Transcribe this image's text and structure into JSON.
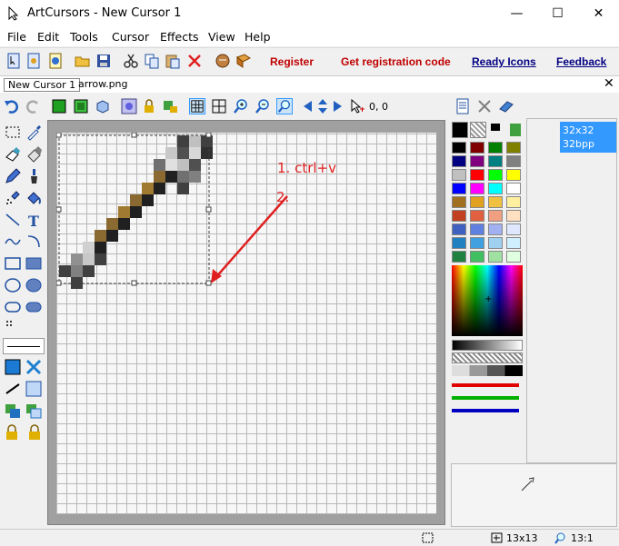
{
  "window": {
    "title": "ArtCursors - New Cursor 1",
    "minimize": "—",
    "maximize": "☐",
    "close": "✕"
  },
  "menu": [
    "File",
    "Edit",
    "Tools",
    "Cursor",
    "Effects",
    "View",
    "Help"
  ],
  "toolbar_links": {
    "register": "Register",
    "get_code": "Get registration code",
    "ready_icons": "Ready Icons",
    "feedback": "Feedback"
  },
  "tabs": [
    {
      "label": "New Cursor 1"
    },
    {
      "label": "arrow.png"
    }
  ],
  "coords": "0, 0",
  "annotations": {
    "step1": "1. ctrl+v",
    "step2": "2."
  },
  "size_item": {
    "line1": "32x32",
    "line2": "32bpp"
  },
  "status": {
    "dimensions": "13x13",
    "zoom": "13:1"
  },
  "colors": {
    "accent": "#3399ff",
    "link_red": "#c00000",
    "link_navy": "#000080",
    "arrow": "#e02020"
  },
  "palette_rows": [
    [
      "#000000",
      "#800000",
      "#008000",
      "#808000"
    ],
    [
      "#000080",
      "#800080",
      "#008080",
      "#808080"
    ],
    [
      "#c0c0c0",
      "#ff0000",
      "#00ff00",
      "#ffff00"
    ],
    [
      "#0000ff",
      "#ff00ff",
      "#00ffff",
      "#ffffff"
    ],
    [
      "#a07020",
      "#e0a020",
      "#f0c040",
      "#fff0a0"
    ],
    [
      "#c04020",
      "#e06040",
      "#f0a080",
      "#ffe0c0"
    ],
    [
      "#4060c0",
      "#6080e0",
      "#a0b0f0",
      "#e0e8ff"
    ],
    [
      "#2080c0",
      "#40a0e0",
      "#a0d0f0",
      "#d0f0ff"
    ],
    [
      "#208040",
      "#40c060",
      "#a0e0a0",
      "#e0ffe0"
    ]
  ]
}
